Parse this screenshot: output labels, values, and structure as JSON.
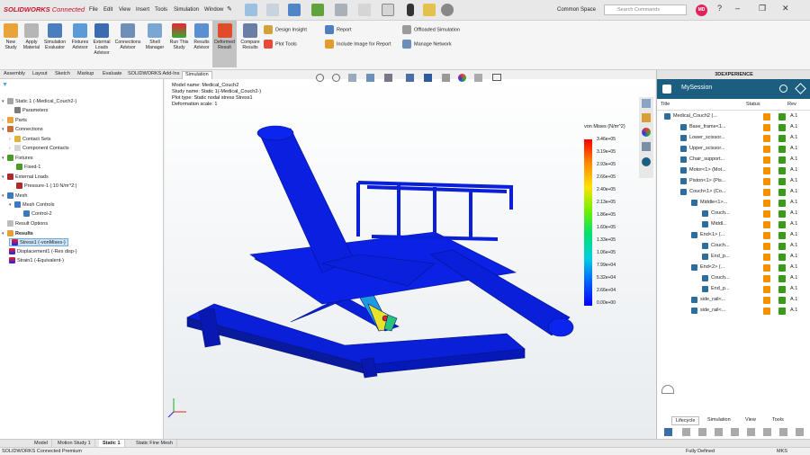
{
  "titlebar": {
    "logo_brand": "SOLIDWORKS",
    "logo_suffix": "Connected",
    "menus": [
      "File",
      "Edit",
      "View",
      "Insert",
      "Tools",
      "Simulation",
      "Window"
    ],
    "common_space": "Common Space",
    "search_placeholder": "Search Commands",
    "avatar_initials": "MD"
  },
  "ribbon": {
    "buttons": [
      {
        "label": "New\nStudy"
      },
      {
        "label": "Apply\nMaterial"
      },
      {
        "label": "Simulation\nEvaluator"
      },
      {
        "label": "Fixtures\nAdvisor"
      },
      {
        "label": "External\nLoads\nAdvisor"
      },
      {
        "label": "Connections\nAdvisor"
      },
      {
        "label": "Shell\nManager"
      },
      {
        "label": "Run This\nStudy"
      },
      {
        "label": "Results\nAdvisor"
      },
      {
        "label": "Deformed\nResult"
      },
      {
        "label": "Compare\nResults"
      }
    ],
    "small": {
      "design_insight": "Design Insight",
      "plot_tools": "Plot Tools",
      "report": "Report",
      "include_image": "Include Image for Report",
      "offloaded_sim": "Offloaded Simulation",
      "manage_network": "Manage Network"
    }
  },
  "tabs": [
    "Assembly",
    "Layout",
    "Sketch",
    "Markup",
    "Evaluate",
    "SOLIDWORKS Add-Ins",
    "Simulation"
  ],
  "tree": {
    "root": "Static 1 (-Medical_Couch2-)",
    "items": [
      {
        "label": "Parameters"
      },
      {
        "label": "Parts"
      },
      {
        "label": "Connections"
      },
      {
        "label": "Contact Sets"
      },
      {
        "label": "Component Contacts"
      },
      {
        "label": "Fixtures"
      },
      {
        "label": "Fixed-1"
      },
      {
        "label": "External Loads"
      },
      {
        "label": "Pressure-1 (:10 N/m^2:)"
      },
      {
        "label": "Mesh"
      },
      {
        "label": "Mesh Controls"
      },
      {
        "label": "Control-2"
      },
      {
        "label": "Result Options"
      },
      {
        "label": "Results"
      },
      {
        "label": "Stress1 (-vonMises-)"
      },
      {
        "label": "Displacement1 (-Res disp-)"
      },
      {
        "label": "Strain1 (-Equivalent-)"
      }
    ]
  },
  "viewport": {
    "model_name": "Model name: Medical_Couch2",
    "study_name": "Study name: Static 1(-Medical_Couch2-)",
    "plot_type": "Plot type: Static nodal stress Stress1",
    "deformation": "Deformation scale: 1",
    "legend_title": "von Mises (N/m^2)",
    "legend_ticks": [
      "3.46e+05",
      "3.19e+05",
      "2.93e+05",
      "2.66e+05",
      "2.40e+05",
      "2.13e+05",
      "1.86e+05",
      "1.60e+05",
      "1.33e+05",
      "1.06e+05",
      "7.99e+04",
      "5.32e+04",
      "2.66e+04",
      "0.00e+00"
    ]
  },
  "rpanel": {
    "header": "3DEXPERIENCE",
    "session": "MySession",
    "col_title": "Title",
    "col_status": "Status",
    "col_rev": "Rev",
    "rows": [
      {
        "name": "Medical_Couch2 (...",
        "rev": "A.1"
      },
      {
        "name": "Base_frame<1...",
        "rev": "A.1"
      },
      {
        "name": "Lower_scissor...",
        "rev": "A.1"
      },
      {
        "name": "Upper_scissor...",
        "rev": "A.1"
      },
      {
        "name": "Chair_support...",
        "rev": "A.1"
      },
      {
        "name": "Motor<1> (Mot...",
        "rev": "A.1"
      },
      {
        "name": "Piston<1> (Pis...",
        "rev": "A.1"
      },
      {
        "name": "Couch<1> (Co...",
        "rev": "A.1"
      },
      {
        "name": "Middle<1>...",
        "rev": "A.1"
      },
      {
        "name": "Couch...",
        "rev": "A.1"
      },
      {
        "name": "Middl...",
        "rev": "A.1"
      },
      {
        "name": "End<1> (...",
        "rev": "A.1"
      },
      {
        "name": "Couch...",
        "rev": "A.1"
      },
      {
        "name": "End_p...",
        "rev": "A.1"
      },
      {
        "name": "End<2> (...",
        "rev": "A.1"
      },
      {
        "name": "Couch...",
        "rev": "A.1"
      },
      {
        "name": "End_p...",
        "rev": "A.1"
      },
      {
        "name": "side_rail<...",
        "rev": "A.1"
      },
      {
        "name": "side_rail<...",
        "rev": "A.1"
      }
    ],
    "bottom_tabs": [
      "Lifecycle",
      "Simulation",
      "View",
      "Tools"
    ]
  },
  "bottom_tabs": [
    "Model",
    "Motion Study 1",
    "Static 1",
    "Static Fine Mesh"
  ],
  "status": {
    "left": "SOLIDWORKS Connected Premium",
    "middle": "Fully Defined",
    "units": "MKS"
  },
  "colors": {
    "accent": "#1b5e80",
    "brand": "#c8102e",
    "model_blue": "#0a1fd8"
  }
}
